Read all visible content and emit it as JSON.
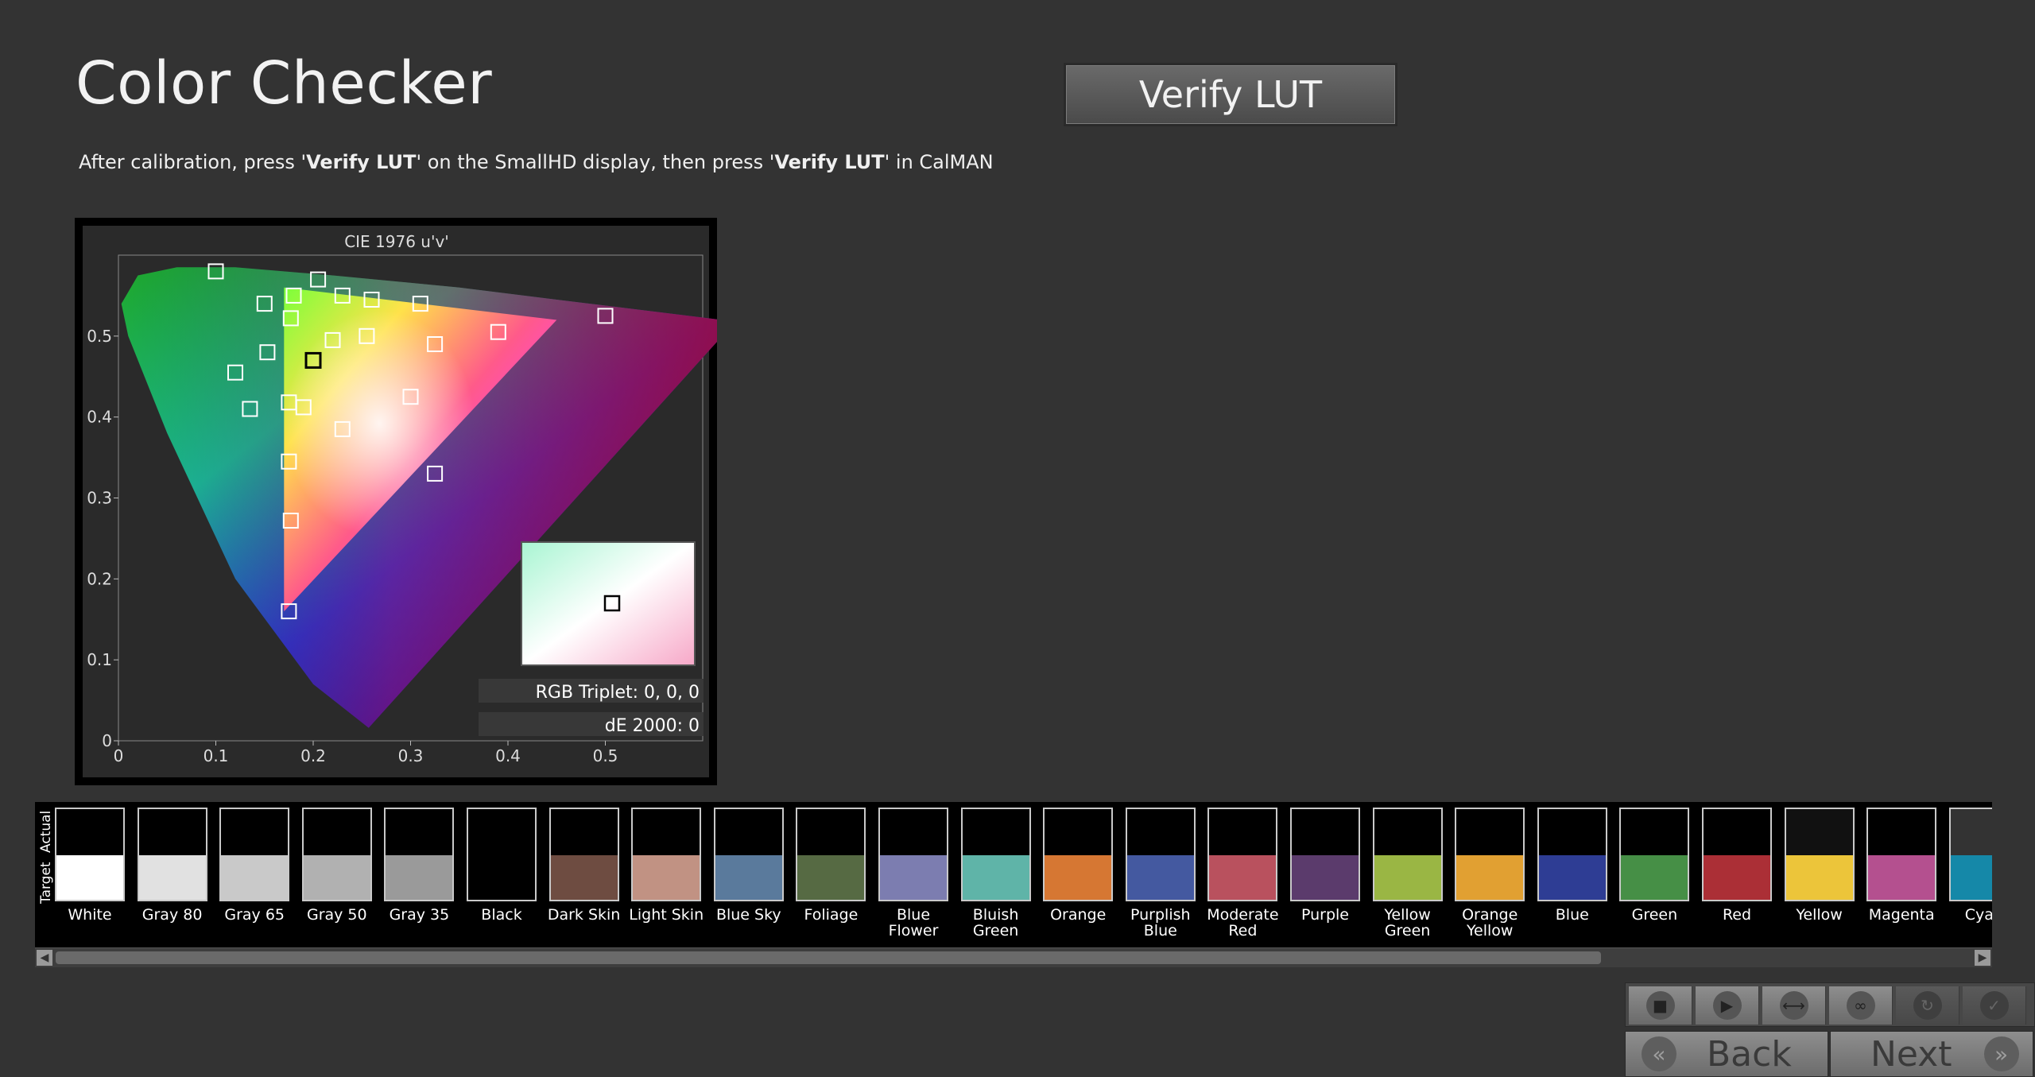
{
  "page": {
    "title": "Color Checker",
    "verify_button": "Verify LUT",
    "instruction": {
      "part1": "After calibration, press '",
      "bold1": "Verify LUT",
      "part2": "' on the SmallHD display, then press '",
      "bold2": "Verify LUT",
      "part3": "' in CalMAN"
    }
  },
  "chart_data": {
    "type": "scatter",
    "title": "CIE 1976 u'v'",
    "xlim": [
      0,
      0.6
    ],
    "ylim": [
      0,
      0.6
    ],
    "x_ticks": [
      "0",
      "0.1",
      "0.2",
      "0.3",
      "0.4",
      "0.5"
    ],
    "y_ticks": [
      "0",
      "0.1",
      "0.2",
      "0.3",
      "0.4",
      "0.5"
    ],
    "gamut_triangle": [
      [
        0.45,
        0.52
      ],
      [
        0.17,
        0.56
      ],
      [
        0.17,
        0.16
      ]
    ],
    "points": [
      [
        0.1,
        0.58
      ],
      [
        0.205,
        0.57
      ],
      [
        0.15,
        0.54
      ],
      [
        0.18,
        0.55
      ],
      [
        0.23,
        0.55
      ],
      [
        0.26,
        0.545
      ],
      [
        0.31,
        0.54
      ],
      [
        0.177,
        0.522
      ],
      [
        0.22,
        0.495
      ],
      [
        0.255,
        0.5
      ],
      [
        0.325,
        0.49
      ],
      [
        0.39,
        0.505
      ],
      [
        0.5,
        0.525
      ],
      [
        0.153,
        0.48
      ],
      [
        0.12,
        0.455
      ],
      [
        0.135,
        0.41
      ],
      [
        0.175,
        0.418
      ],
      [
        0.19,
        0.412
      ],
      [
        0.23,
        0.385
      ],
      [
        0.3,
        0.425
      ],
      [
        0.175,
        0.345
      ],
      [
        0.325,
        0.33
      ],
      [
        0.177,
        0.272
      ],
      [
        0.175,
        0.16
      ]
    ],
    "highlight_point": [
      0.2,
      0.47
    ],
    "info": {
      "rgb_triplet": "RGB Triplet: 0, 0, 0",
      "de": "dE 2000: 0"
    },
    "colors": {
      "background": "#2a2a2a",
      "marker": "#ffffff",
      "highlight": "#000000"
    }
  },
  "swatches": {
    "actual_label": "Actual",
    "target_label": "Target",
    "items": [
      {
        "label": "White",
        "label2": "",
        "target": "#ffffff",
        "actual": "#000000"
      },
      {
        "label": "Gray 80",
        "label2": "",
        "target": "#e1e1e1",
        "actual": "#000000"
      },
      {
        "label": "Gray 65",
        "label2": "",
        "target": "#c9c9c9",
        "actual": "#000000"
      },
      {
        "label": "Gray 50",
        "label2": "",
        "target": "#b1b1b1",
        "actual": "#000000"
      },
      {
        "label": "Gray 35",
        "label2": "",
        "target": "#9a9a9a",
        "actual": "#000000"
      },
      {
        "label": "Black",
        "label2": "",
        "target": "#000000",
        "actual": "#000000"
      },
      {
        "label": "Dark Skin",
        "label2": "",
        "target": "#6e4c41",
        "actual": "#000000"
      },
      {
        "label": "Light Skin",
        "label2": "",
        "target": "#c19283",
        "actual": "#000000"
      },
      {
        "label": "Blue Sky",
        "label2": "",
        "target": "#5a7a9c",
        "actual": "#000000"
      },
      {
        "label": "Foliage",
        "label2": "",
        "target": "#566a43",
        "actual": "#000000"
      },
      {
        "label": "Blue",
        "label2": "Flower",
        "target": "#7c7db0",
        "actual": "#000000"
      },
      {
        "label": "Bluish",
        "label2": "Green",
        "target": "#5fb4a8",
        "actual": "#000000"
      },
      {
        "label": "Orange",
        "label2": "",
        "target": "#d67733",
        "actual": "#000000"
      },
      {
        "label": "Purplish",
        "label2": "Blue",
        "target": "#4459a0",
        "actual": "#000000"
      },
      {
        "label": "Moderate",
        "label2": "Red",
        "target": "#b9515e",
        "actual": "#000000"
      },
      {
        "label": "Purple",
        "label2": "",
        "target": "#5b3b6c",
        "actual": "#000000"
      },
      {
        "label": "Yellow",
        "label2": "Green",
        "target": "#9ab644",
        "actual": "#000000"
      },
      {
        "label": "Orange",
        "label2": "Yellow",
        "target": "#e1a032",
        "actual": "#000000"
      },
      {
        "label": "Blue",
        "label2": "",
        "target": "#2e3d94",
        "actual": "#000000"
      },
      {
        "label": "Green",
        "label2": "",
        "target": "#468f46",
        "actual": "#000000"
      },
      {
        "label": "Red",
        "label2": "",
        "target": "#ab2f36",
        "actual": "#000000"
      },
      {
        "label": "Yellow",
        "label2": "",
        "target": "#ecc53a",
        "actual": "#111111"
      },
      {
        "label": "Magenta",
        "label2": "",
        "target": "#b4508f",
        "actual": "#000000"
      },
      {
        "label": "Cyan",
        "label2": "",
        "target": "#1588a8",
        "actual": "#333333"
      }
    ]
  },
  "toolbar": {
    "buttons": [
      {
        "name": "stop-icon",
        "glyph": "■",
        "enabled": true
      },
      {
        "name": "play-icon",
        "glyph": "▶",
        "enabled": true
      },
      {
        "name": "fit-icon",
        "glyph": "⟷",
        "enabled": true
      },
      {
        "name": "loop-icon",
        "glyph": "∞",
        "enabled": true
      },
      {
        "name": "refresh-icon",
        "glyph": "↻",
        "enabled": false
      },
      {
        "name": "check-icon",
        "glyph": "✓",
        "enabled": false
      }
    ]
  },
  "nav": {
    "back_label": "Back",
    "next_label": "Next",
    "back_glyph": "«",
    "next_glyph": "»"
  }
}
